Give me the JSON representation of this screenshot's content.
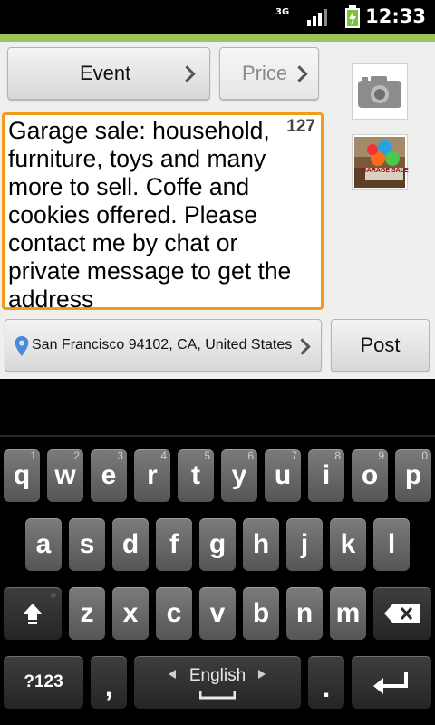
{
  "status_bar": {
    "network": "3G",
    "time": "12:33"
  },
  "colors": {
    "accent_orange": "#f29b1d",
    "green_bar": "#98c55a",
    "battery_green": "#7ec23b"
  },
  "toolbar": {
    "event_label": "Event",
    "price_label": "Price"
  },
  "description": {
    "text": "Garage sale: household, furniture, toys and many more to sell. Coffe and cookies offered. Please contact me by chat or private message to get the address",
    "remaining_chars": "127"
  },
  "media": {
    "camera_icon": "camera-icon",
    "thumbnail_caption": "GARAGE SALE"
  },
  "location": {
    "text": "San Francisco 94102, CA, United States",
    "icon": "location-pin-icon"
  },
  "post_label": "Post",
  "keyboard": {
    "row1": [
      {
        "ch": "q",
        "num": "1"
      },
      {
        "ch": "w",
        "num": "2"
      },
      {
        "ch": "e",
        "num": "3"
      },
      {
        "ch": "r",
        "num": "4"
      },
      {
        "ch": "t",
        "num": "5"
      },
      {
        "ch": "y",
        "num": "6"
      },
      {
        "ch": "u",
        "num": "7"
      },
      {
        "ch": "i",
        "num": "8"
      },
      {
        "ch": "o",
        "num": "9"
      },
      {
        "ch": "p",
        "num": "0"
      }
    ],
    "row2": [
      "a",
      "s",
      "d",
      "f",
      "g",
      "h",
      "j",
      "k",
      "l"
    ],
    "row3": [
      "z",
      "x",
      "c",
      "v",
      "b",
      "n",
      "m"
    ],
    "symbols_label": "?123",
    "comma_label": ",",
    "language_label": "English",
    "period_label": "."
  }
}
